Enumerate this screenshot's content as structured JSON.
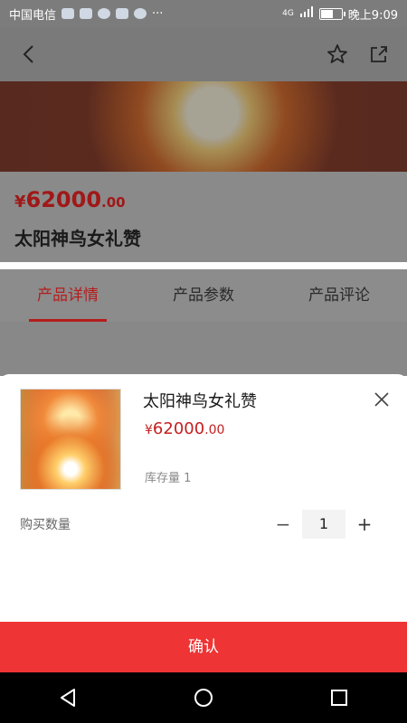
{
  "status_bar": {
    "carrier": "中国电信",
    "more": "···",
    "network": "4G",
    "time": "晚上9:09",
    "battery_level": 0.55
  },
  "product": {
    "currency": "¥",
    "price_int": "62000",
    "price_dec": ".00",
    "title": "太阳神鸟女礼赞"
  },
  "tabs": [
    "产品详情",
    "产品参数",
    "产品评论"
  ],
  "sheet": {
    "title": "太阳神鸟女礼赞",
    "currency": "¥",
    "price_int": "62000",
    "price_dec": ".00",
    "stock": "库存量 1",
    "qty_label": "购买数量",
    "qty_minus": "−",
    "qty_value": "1",
    "qty_plus": "+",
    "confirm": "确认"
  },
  "icons": {
    "back": "back-arrow-icon",
    "favorite": "star-icon",
    "share": "share-icon",
    "close": "close-icon",
    "nav_back": "nav-back-icon",
    "nav_home": "nav-home-icon",
    "nav_recent": "nav-recent-icon"
  },
  "colors": {
    "accent": "#ee3434",
    "price": "#c42020"
  }
}
